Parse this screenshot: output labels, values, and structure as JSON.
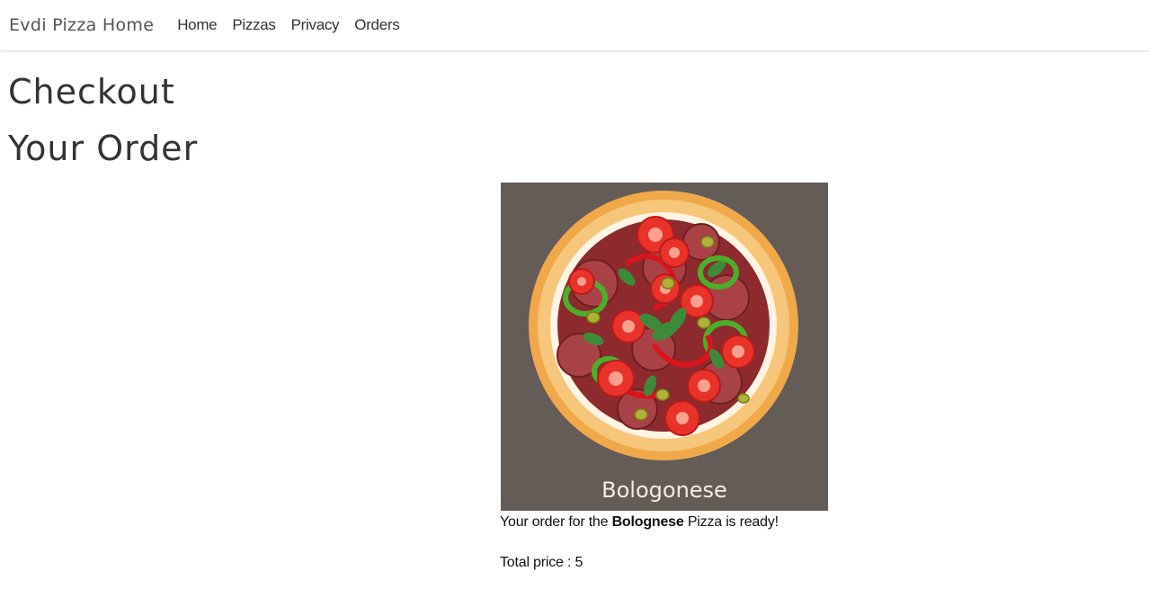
{
  "navbar": {
    "brand": "Evdi Pizza Home",
    "links": [
      "Home",
      "Pizzas",
      "Privacy",
      "Orders"
    ]
  },
  "page": {
    "title": "Checkout",
    "subtitle": "Your Order"
  },
  "order": {
    "image_caption": "Bologonese",
    "text_before": "Your order for the ",
    "pizza_name": "Bolognese",
    "text_after": " Pizza is ready!",
    "price_label": "Total price : ",
    "price_value": "5"
  },
  "colors": {
    "image_background": "#645c56",
    "crust": "#f2b257",
    "sauce": "#8c2a2e",
    "tomato": "#e8322a",
    "pepper_green": "#4caf2a"
  }
}
